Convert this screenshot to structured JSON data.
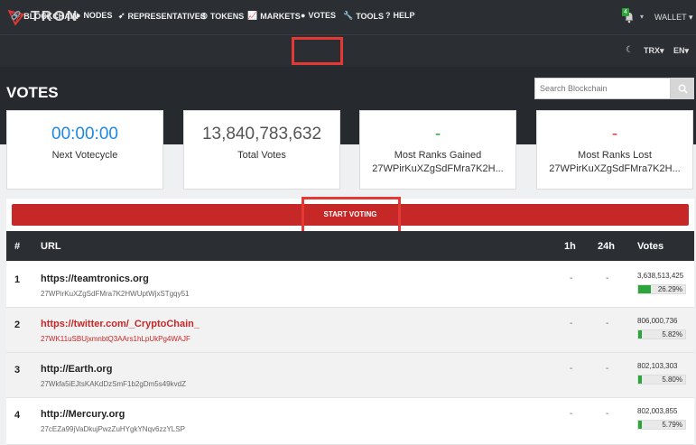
{
  "brand": {
    "name": "TRON"
  },
  "topbar": {
    "notification_count": "4",
    "wallet_label": "WALLET"
  },
  "nav": {
    "items": [
      {
        "label": "BLOCKCHAIN",
        "icon": "link-icon",
        "glyph": "🔗"
      },
      {
        "label": "NODES",
        "icon": "map-marker-icon",
        "glyph": "●"
      },
      {
        "label": "REPRESENTATIVES",
        "icon": "rocket-icon",
        "glyph": "➹"
      },
      {
        "label": "TOKENS",
        "icon": "token-icon",
        "glyph": "◎"
      },
      {
        "label": "MARKETS",
        "icon": "chart-icon",
        "glyph": "📈"
      },
      {
        "label": "VOTES",
        "icon": "comment-icon",
        "glyph": "●"
      },
      {
        "label": "TOOLS",
        "icon": "wrench-icon",
        "glyph": "🔧"
      },
      {
        "label": "HELP",
        "icon": "question-icon",
        "glyph": "?"
      }
    ],
    "currency": "TRX",
    "language": "EN"
  },
  "page": {
    "title": "VOTES"
  },
  "search": {
    "placeholder": "Search Blockchain"
  },
  "cards": [
    {
      "value": "00:00:00",
      "label": "Next Votecycle",
      "sub": "",
      "color": "#1e88e5"
    },
    {
      "value": "13,840,783,632",
      "label": "Total Votes",
      "sub": "",
      "color": "#555555"
    },
    {
      "value": "-",
      "label": "Most Ranks Gained",
      "sub": "27WPirKuXZgSdFMra7K2H...",
      "color": "#2ca53a"
    },
    {
      "value": "-",
      "label": "Most Ranks Lost",
      "sub": "27WPirKuXZgSdFMra7K2H...",
      "color": "#e53935"
    }
  ],
  "start_voting_label": "START VOTING",
  "table": {
    "headers": {
      "rank": "#",
      "url": "URL",
      "h1": "1h",
      "h24": "24h",
      "votes": "Votes"
    },
    "rows": [
      {
        "rank": "1",
        "url": "https://teamtronics.org",
        "address": "27WPirKuXZgSdFMra7K2HWUptWjxSTgqy51",
        "h1": "-",
        "h24": "-",
        "votes": "3,638,513,425",
        "percent": "26.29%",
        "fraction": 0.2629
      },
      {
        "rank": "2",
        "url": "https://twitter.com/_CryptoChain_",
        "address": "27WK11uSBUjxmnbtQ3AArs1hLpUkPg4WAJF",
        "h1": "-",
        "h24": "-",
        "votes": "806,000,736",
        "percent": "5.82%",
        "fraction": 0.0582
      },
      {
        "rank": "3",
        "url": "http://Earth.org",
        "address": "27Wkfa5iEJtsKAKdDzSmF1b2gDm5s49kvdZ",
        "h1": "-",
        "h24": "-",
        "votes": "802,103,303",
        "percent": "5.80%",
        "fraction": 0.058
      },
      {
        "rank": "4",
        "url": "http://Mercury.org",
        "address": "27cEZa99jVaDkujPwzZuHYgkYNqv6zzYLSP",
        "h1": "-",
        "h24": "-",
        "votes": "802,003,855",
        "percent": "5.79%",
        "fraction": 0.0579
      }
    ]
  }
}
